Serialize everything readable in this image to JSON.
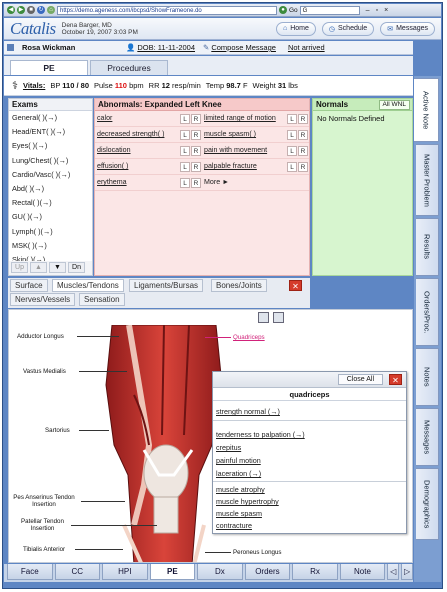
{
  "browser": {
    "url": "https://demo.ageness.com/ibcpsd/ShowFrameone.do",
    "go": "Go",
    "search_hint": "G"
  },
  "app": {
    "logo": "Catalis",
    "user_name": "Dena Barger, MD",
    "user_date": "October 19, 2007 3:03 PM",
    "home": "Home",
    "schedule": "Schedule",
    "messages": "Messages"
  },
  "patient": {
    "name": "Rosa Wickman",
    "dob": "DOB: 11-11-2004",
    "compose": "Compose Message",
    "status": "Not arrived"
  },
  "tabs": [
    "PE",
    "Procedures"
  ],
  "vitals": {
    "label": "Vitals:",
    "bp_label": "BP",
    "bp": "110 / 80",
    "pulse_label": "Pulse",
    "pulse": "110",
    "pulse_unit": "bpm",
    "rr_label": "RR",
    "rr": "12",
    "rr_unit": "resp/min",
    "temp_label": "Temp",
    "temp": "98.7",
    "temp_unit": "F",
    "weight_label": "Weight",
    "weight": "31",
    "weight_unit": "lbs"
  },
  "exams": {
    "heading": "Exams",
    "items": [
      "General( )(→)",
      "Head/ENT( )(→)",
      "Eyes( )(→)",
      "Lung/Chest( )(→)",
      "Cardio/Vasc( )(→)",
      "Abd( )(→)",
      "Rectal( )(→)",
      "GU( )(→)",
      "Lymph( )(→)",
      "MSK( )(→)",
      "Skin( )(→)"
    ],
    "nav": [
      "Up",
      "▲",
      "▼",
      "Dn"
    ]
  },
  "abnormals": {
    "heading": "Abnormals: Expanded Left Knee",
    "rows": [
      [
        "calor",
        "limited range of motion"
      ],
      [
        "decreased strength( )",
        "muscle spasm( )"
      ],
      [
        "dislocation",
        "pain with movement"
      ],
      [
        "effusion( )",
        "palpable fracture"
      ],
      [
        "erythema",
        "More ►"
      ]
    ],
    "l": "L",
    "r": "R"
  },
  "normals": {
    "heading": "Normals",
    "all_wnl": "All WNL",
    "empty": "No Normals Defined"
  },
  "image_tabs": [
    "Surface",
    "Muscles/Tendons",
    "Ligaments/Bursas",
    "Bones/Joints",
    "Nerves/Vessels",
    "Sensation"
  ],
  "anatomy_labels": {
    "adductor": "Adductor Longus",
    "vastus": "Vastus Medialis",
    "sartorius": "Sartorius",
    "pes": "Pes Anserinus Tendon Insertion",
    "patellar": "Patellar Tendon Insertion",
    "tibialis": "Tibialis Anterior",
    "quadriceps": "Quadriceps",
    "peroneus": "Peroneus Longus"
  },
  "popup": {
    "close_all": "Close All",
    "title": "quadriceps",
    "items": [
      "strength normal (→)",
      "tenderness to palpation (→)",
      "crepitus",
      "painful motion",
      "laceration (→)",
      "muscle atrophy",
      "muscle hypertrophy",
      "muscle spasm",
      "contracture"
    ]
  },
  "bottom_tabs": [
    "Face",
    "CC",
    "HPI",
    "PE",
    "Dx",
    "Orders",
    "Rx",
    "Note"
  ],
  "side_tabs": [
    "Active Note",
    "Master Problem",
    "Results",
    "Orders/Proc.",
    "Notes",
    "Messages",
    "Demographics"
  ],
  "colors": {
    "abn_bg": "#fbe6e6",
    "norm_bg": "#d7f5cf",
    "vital_red": "#dd1111",
    "frame_blue": "#5e86c4"
  }
}
